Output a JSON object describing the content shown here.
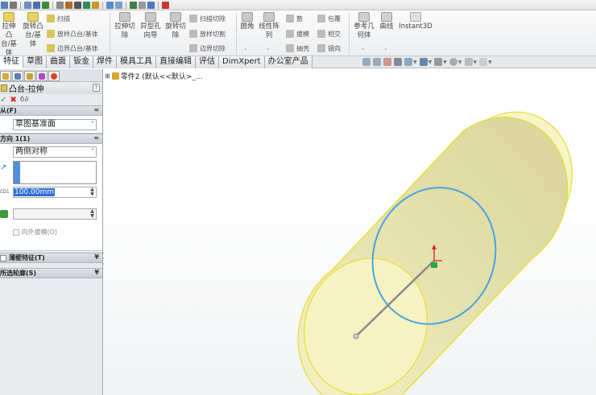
{
  "ribbon": {
    "extrude_boss": "拉伸凸\n台/基\n体",
    "revolve_boss": "旋转凸\n台/基\n体",
    "sweep": "扫描",
    "loft_boss": "放样凸台/基体",
    "boundary_boss": "边界凸台/基体",
    "extrude_cut": "拉伸切\n除",
    "hole_wizard": "异型孔\n向导",
    "revolve_cut": "旋转切\n除",
    "swept_cut": "扫描切除",
    "lofted_cut": "放样切割",
    "boundary_cut": "边界切除",
    "fillet": "圆角",
    "linear_pattern": "线性阵\n列",
    "rib": "筋",
    "draft": "拔模",
    "shell": "抽壳",
    "wrap": "包覆",
    "intersect": "相交",
    "mirror": "镜向",
    "ref_geometry": "参考几\n何体",
    "curves": "曲线",
    "instant3d": "Instant3D"
  },
  "tabs": [
    "特征",
    "草图",
    "曲面",
    "钣金",
    "焊件",
    "模具工具",
    "直接编辑",
    "评估",
    "DimXpert",
    "办公室产品"
  ],
  "tree": {
    "label": "零件2  (默认<<默认>_..."
  },
  "panel": {
    "title": "凸台-拉伸",
    "help": "?",
    "from_group": "从(F)",
    "from_value": "草图基准面",
    "dir1_group": "方向 1(1)",
    "end_condition": "两侧对称",
    "depth": "100.00mm",
    "draft_outward": "向外拔模(O)",
    "thin_feature": "薄壁特征(T)",
    "selected_contours": "所选轮廓(S)"
  },
  "colors": {
    "cylinder_fill": "#f5f3c4",
    "cylinder_edge": "#e8e23a",
    "sketch_circle": "#4aa3e0",
    "accent_blue": "#2f6fd8"
  }
}
